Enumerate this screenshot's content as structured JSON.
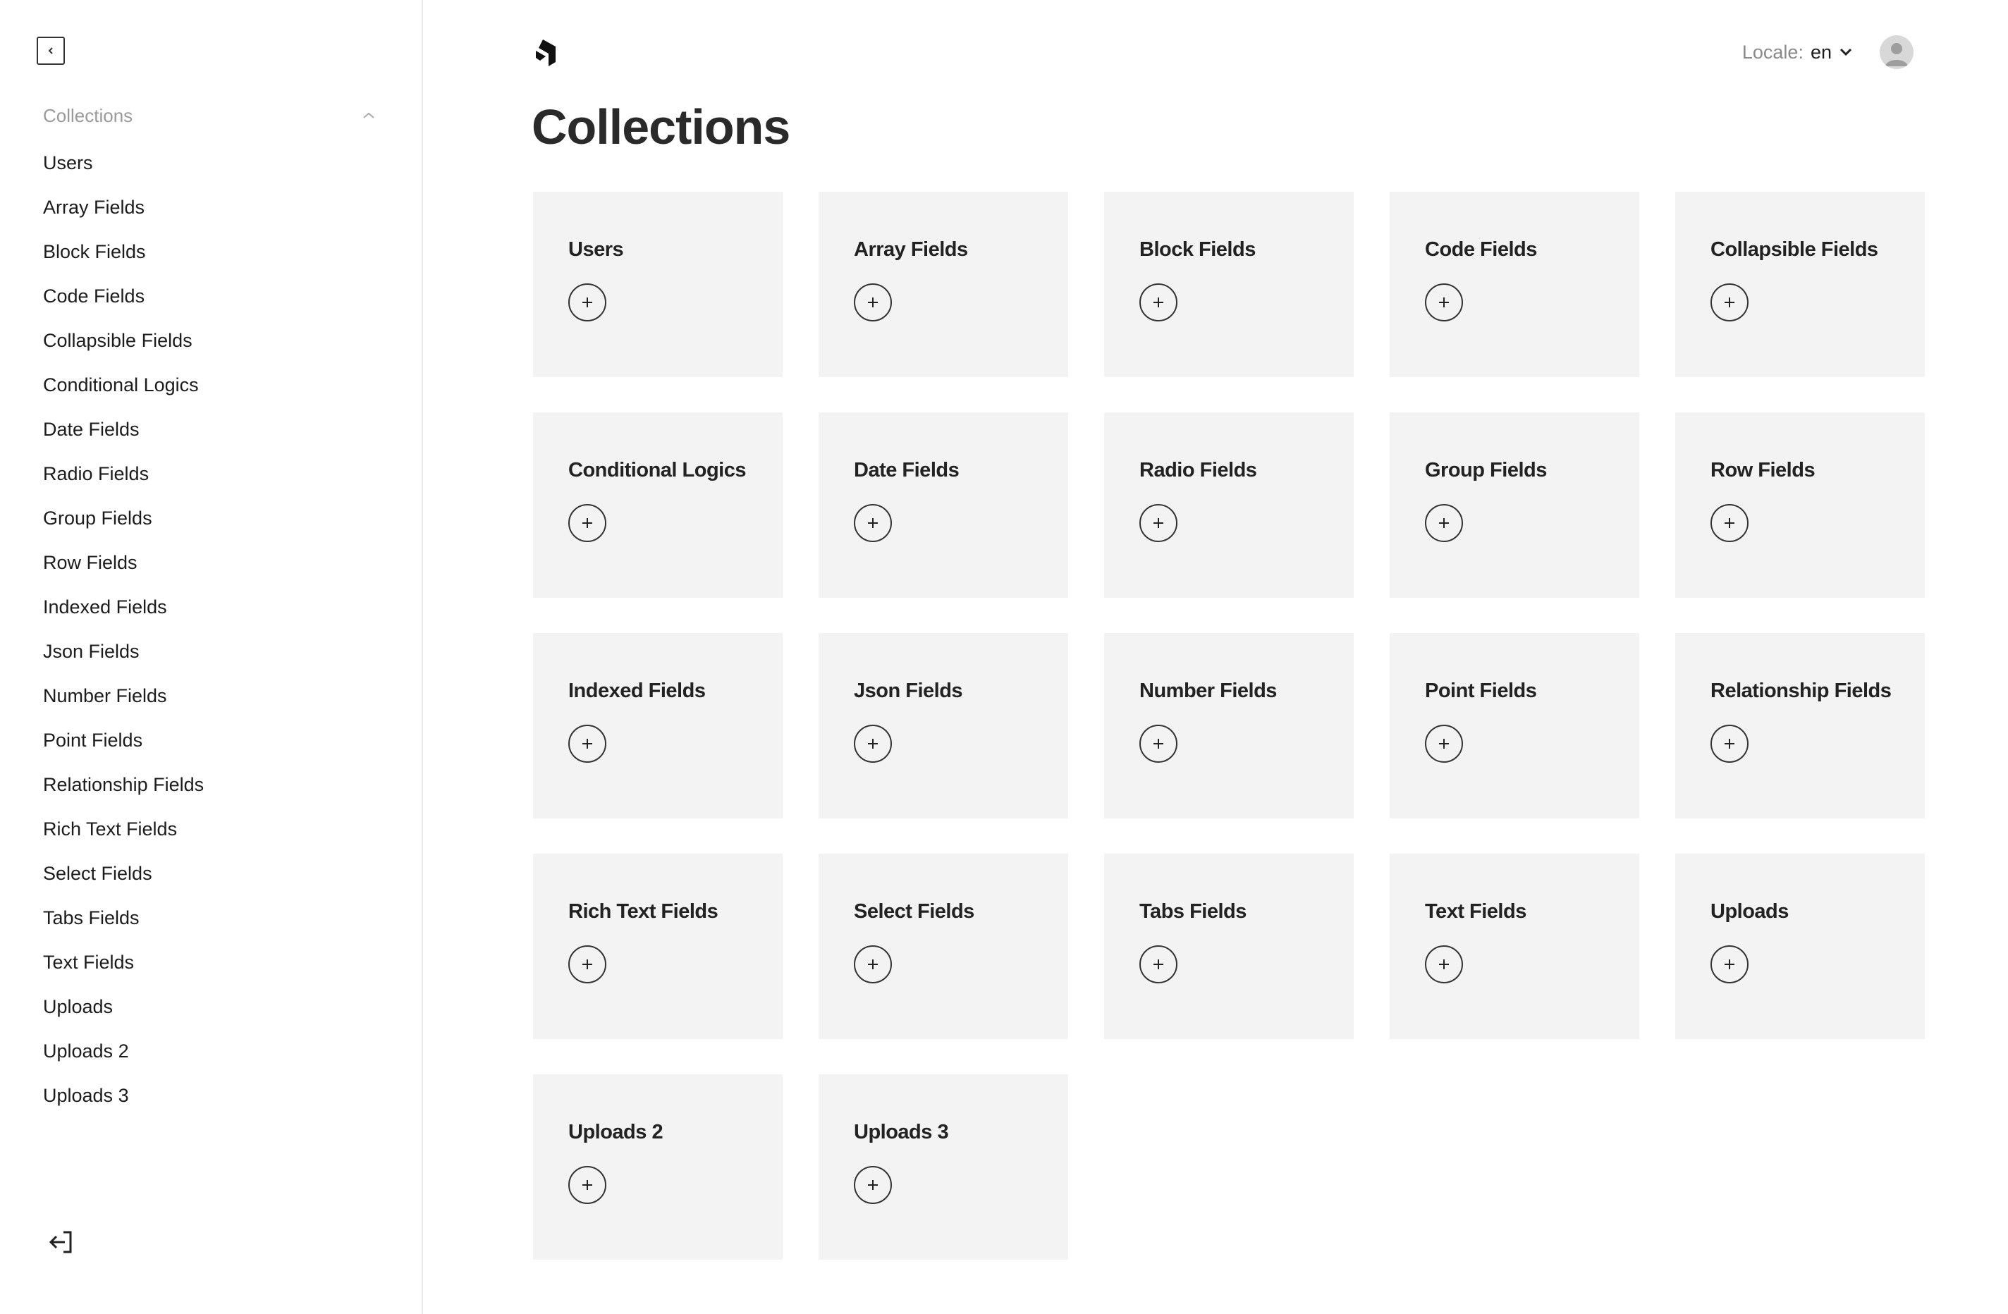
{
  "sidebar": {
    "group_label": "Collections",
    "items": [
      {
        "label": "Users",
        "slug": "users"
      },
      {
        "label": "Array Fields",
        "slug": "array-fields"
      },
      {
        "label": "Block Fields",
        "slug": "block-fields"
      },
      {
        "label": "Code Fields",
        "slug": "code-fields"
      },
      {
        "label": "Collapsible Fields",
        "slug": "collapsible-fields"
      },
      {
        "label": "Conditional Logics",
        "slug": "conditional-logics"
      },
      {
        "label": "Date Fields",
        "slug": "date-fields"
      },
      {
        "label": "Radio Fields",
        "slug": "radio-fields"
      },
      {
        "label": "Group Fields",
        "slug": "group-fields"
      },
      {
        "label": "Row Fields",
        "slug": "row-fields"
      },
      {
        "label": "Indexed Fields",
        "slug": "indexed-fields"
      },
      {
        "label": "Json Fields",
        "slug": "json-fields"
      },
      {
        "label": "Number Fields",
        "slug": "number-fields"
      },
      {
        "label": "Point Fields",
        "slug": "point-fields"
      },
      {
        "label": "Relationship Fields",
        "slug": "relationship-fields"
      },
      {
        "label": "Rich Text Fields",
        "slug": "rich-text-fields"
      },
      {
        "label": "Select Fields",
        "slug": "select-fields"
      },
      {
        "label": "Tabs Fields",
        "slug": "tabs-fields"
      },
      {
        "label": "Text Fields",
        "slug": "text-fields"
      },
      {
        "label": "Uploads",
        "slug": "uploads"
      },
      {
        "label": "Uploads 2",
        "slug": "uploads-2"
      },
      {
        "label": "Uploads 3",
        "slug": "uploads-3"
      }
    ]
  },
  "header": {
    "locale_label": "Locale:",
    "locale_value": "en"
  },
  "main": {
    "title": "Collections",
    "cards": [
      {
        "title": "Users",
        "slug": "users"
      },
      {
        "title": "Array Fields",
        "slug": "array-fields"
      },
      {
        "title": "Block Fields",
        "slug": "block-fields"
      },
      {
        "title": "Code Fields",
        "slug": "code-fields"
      },
      {
        "title": "Collapsible Fields",
        "slug": "collapsible-fields"
      },
      {
        "title": "Conditional Logics",
        "slug": "conditional-logics"
      },
      {
        "title": "Date Fields",
        "slug": "date-fields"
      },
      {
        "title": "Radio Fields",
        "slug": "radio-fields"
      },
      {
        "title": "Group Fields",
        "slug": "group-fields"
      },
      {
        "title": "Row Fields",
        "slug": "row-fields"
      },
      {
        "title": "Indexed Fields",
        "slug": "indexed-fields"
      },
      {
        "title": "Json Fields",
        "slug": "json-fields"
      },
      {
        "title": "Number Fields",
        "slug": "number-fields"
      },
      {
        "title": "Point Fields",
        "slug": "point-fields"
      },
      {
        "title": "Relationship Fields",
        "slug": "relationship-fields"
      },
      {
        "title": "Rich Text Fields",
        "slug": "rich-text-fields"
      },
      {
        "title": "Select Fields",
        "slug": "select-fields"
      },
      {
        "title": "Tabs Fields",
        "slug": "tabs-fields"
      },
      {
        "title": "Text Fields",
        "slug": "text-fields"
      },
      {
        "title": "Uploads",
        "slug": "uploads"
      },
      {
        "title": "Uploads 2",
        "slug": "uploads-2"
      },
      {
        "title": "Uploads 3",
        "slug": "uploads-3"
      }
    ]
  },
  "icons": {
    "collapse": "chevron-left-icon",
    "group_toggle": "chevron-up-icon",
    "logout": "logout-icon",
    "logo": "payload-logo",
    "locale_dropdown": "chevron-down-icon",
    "avatar": "user-avatar-icon",
    "add": "plus-icon"
  },
  "colors": {
    "card_background": "#f3f3f3",
    "text_primary": "#222222",
    "text_muted": "#9a9a9a",
    "border": "#e8e8e8"
  }
}
